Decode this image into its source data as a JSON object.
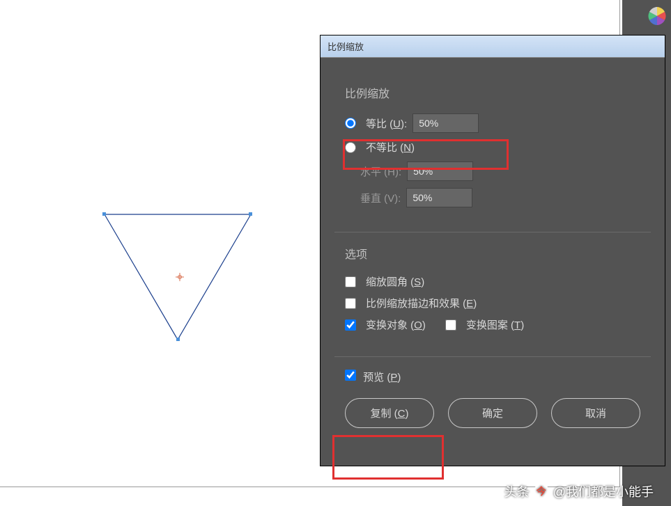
{
  "dialog": {
    "title": "比例缩放",
    "scale_section": {
      "title": "比例缩放",
      "uniform": {
        "label_pre": "等比 (",
        "key": "U",
        "label_post": "):",
        "value": "50%"
      },
      "nonuniform": {
        "label_pre": "不等比 (",
        "key": "N",
        "label_post": ")"
      },
      "horizontal": {
        "label": "水平 (H):",
        "value": "50%"
      },
      "vertical": {
        "label": "垂直 (V):",
        "value": "50%"
      }
    },
    "options_section": {
      "title": "选项",
      "scale_corners": {
        "label_pre": "缩放圆角 (",
        "key": "S",
        "label_post": ")"
      },
      "scale_strokes": {
        "label_pre": "比例缩放描边和效果 (",
        "key": "E",
        "label_post": ")"
      },
      "transform_objects": {
        "label_pre": "变换对象 (",
        "key": "O",
        "label_post": ")"
      },
      "transform_patterns": {
        "label_pre": "变换图案 (",
        "key": "T",
        "label_post": ")"
      }
    },
    "preview": {
      "label_pre": "预览 (",
      "key": "P",
      "label_post": ")"
    },
    "buttons": {
      "copy": {
        "label_pre": "复制 (",
        "key": "C",
        "label_post": ")"
      },
      "ok": "确定",
      "cancel": "取消"
    }
  },
  "watermark": {
    "text": "@我们都是小能手",
    "prefix": "头条"
  }
}
